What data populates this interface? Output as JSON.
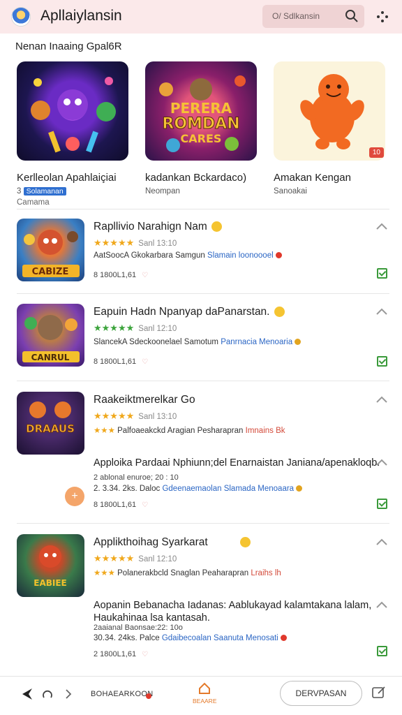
{
  "header": {
    "title": "Apllaiylansin",
    "search_placeholder": "O/ Sdlkansin"
  },
  "featured": {
    "title": "Nenan Inaaing Gpal6R",
    "cards": [
      {
        "name": "Kerlleolan Apahlaiçiai",
        "tag": "3",
        "tag_badge": "Solamanan",
        "sub2": "Camama"
      },
      {
        "name": "kadankan Bckardaco)",
        "sub": "Neompan",
        "art_text": "PERERA ROMDAN CARES"
      },
      {
        "name": "Amakan Kengan",
        "sub": "Sanoakai",
        "badge": "10"
      }
    ]
  },
  "list": [
    {
      "title": "Rapllivio Narahign Nam",
      "rating_meta": "Sanl 13:10",
      "meta": "AatSoocA Gkokarbara Samgun",
      "meta_link": "Slamain loonoooel",
      "stat": "8 1800L1,61",
      "thumb_text": "CABIZE",
      "star_color": "#f0a81c"
    },
    {
      "title": "Eapuin Hadn Npanyap daPanarstan.",
      "rating_meta": "Sanl 12:10",
      "meta": "SlancekA Sdeckoonelael Samotum",
      "meta_link": "Panrnacia Menoaria",
      "stat": "8 1800L1,61",
      "thumb_text": "CANRUL",
      "star_color": "#3ca43c"
    },
    {
      "title": "Raakeiktmerelkar Go",
      "rating_meta": "Sanl 13:10",
      "meta": "Palfoaeakckd Aragian Pesharapran",
      "meta_link": "Imnains Bk",
      "thumb_text": "DRAAUS",
      "star_color": "#f0a81c",
      "subtitle": "Apploika Pardaai Nphiunn;del Enarnaistan Janiana/apenakloqb.",
      "sub_meta1": "2 ablonal enuroe; 20 : 10",
      "sub_meta2": "2. 3.34. 2ks. Daloc",
      "sub_meta_link": "Gdeenaemaolan",
      "sub_meta_link2": "Slamada Menoaara",
      "stat": "8 1800L1,61"
    },
    {
      "title": "Applikthoihag Syarkarat",
      "rating_meta": "Sanl 12:10",
      "meta": "Polanerakbcld Snaglan Peaharapran",
      "meta_link": "Lraihs lh",
      "thumb_text": "EABIEE",
      "star_color": "#f0a81c",
      "subtitle": "Aopanin Bebanacha Iadanas: Aablukayad kalamtakana lalam, Haukahinaa lsa kantasah.",
      "sub_meta1": "2aaianal Baonsae:22: 10o",
      "sub_meta2": "30.34. 24ks. Palce",
      "sub_meta_link": "Gdaibecoalan",
      "sub_meta_link2": "Saanuta Menosati",
      "stat": "2 1800L1,61"
    }
  ],
  "bottom": {
    "label": "BOHAEARKOON",
    "home_label": "BEAARE",
    "action_label": "DERVPASAN"
  },
  "colors": {
    "header_bg": "#fbe9ea",
    "accent_blue": "#2b66c4",
    "accent_red": "#d34a3a",
    "check_green": "#3a9a3a"
  }
}
